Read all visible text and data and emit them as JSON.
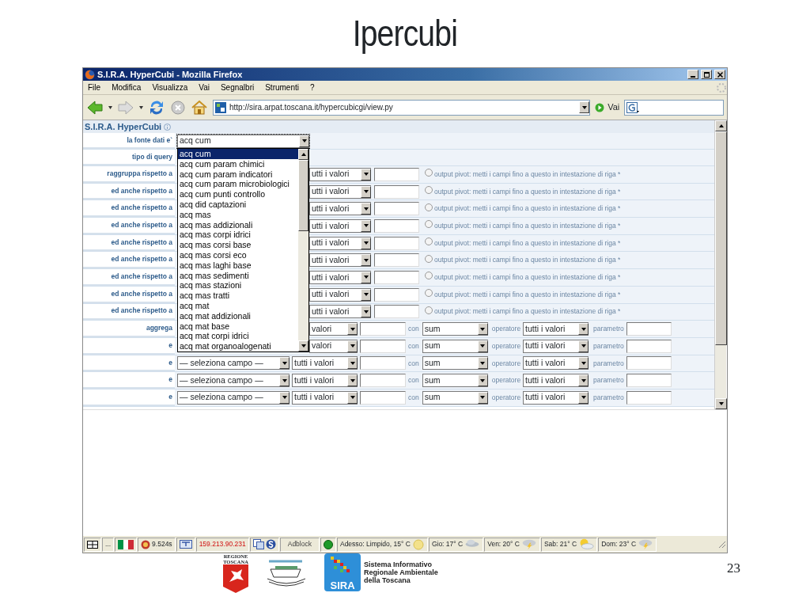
{
  "slide": {
    "title": "Ipercubi",
    "page_number": "23"
  },
  "window": {
    "title": "S.I.R.A. HyperCubi - Mozilla Firefox"
  },
  "menu": [
    "File",
    "Modifica",
    "Visualizza",
    "Vai",
    "Segnalbri",
    "Strumenti",
    "?"
  ],
  "toolbar": {
    "address": "http://sira.arpat.toscana.it/hypercubicgi/view.py",
    "go_label": "Vai"
  },
  "page": {
    "heading": "S.I.R.A. HyperCubi",
    "source": {
      "label": "la fonte dati e`",
      "value": "acq cum",
      "options": [
        {
          "label": "acq cum",
          "selected": true
        },
        {
          "label": "acq cum param chimici",
          "selected": false
        },
        {
          "label": "acq cum param indicatori",
          "selected": false
        },
        {
          "label": "acq cum param microbiologici",
          "selected": false
        },
        {
          "label": "acq cum punti controllo",
          "selected": false
        },
        {
          "label": "acq did captazioni",
          "selected": false
        },
        {
          "label": "acq mas",
          "selected": false
        },
        {
          "label": "acq mas addizionali",
          "selected": false
        },
        {
          "label": "acq mas corpi idrici",
          "selected": false
        },
        {
          "label": "acq mas corsi base",
          "selected": false
        },
        {
          "label": "acq mas corsi eco",
          "selected": false
        },
        {
          "label": "acq mas laghi base",
          "selected": false
        },
        {
          "label": "acq mas sedimenti",
          "selected": false
        },
        {
          "label": "acq mas stazioni",
          "selected": false
        },
        {
          "label": "acq mas tratti",
          "selected": false
        },
        {
          "label": "acq mat",
          "selected": false
        },
        {
          "label": "acq mat addizionali",
          "selected": false
        },
        {
          "label": "acq mat base",
          "selected": false
        },
        {
          "label": "acq mat corpi idrici",
          "selected": false
        },
        {
          "label": "acq mat organoalogenati",
          "selected": false
        }
      ]
    },
    "query_type": {
      "label": "tipo di query"
    },
    "group_rows": [
      {
        "label": "raggruppa rispetto a",
        "values": "utti i valori",
        "pivot_checked": false,
        "pivot_label": "output pivot: metti i campi fino a questo in intestazione di riga *"
      },
      {
        "label": "ed anche rispetto a",
        "values": "utti i valori",
        "pivot_checked": false,
        "pivot_label": "output pivot: metti i campi fino a questo in intestazione di riga *"
      },
      {
        "label": "ed anche rispetto a",
        "values": "utti i valori",
        "pivot_checked": false,
        "pivot_label": "output pivot: metti i campi fino a questo in intestazione di riga *"
      },
      {
        "label": "ed anche rispetto a",
        "values": "utti i valori",
        "pivot_checked": false,
        "pivot_label": "output pivot: metti i campi fino a questo in intestazione di riga *"
      },
      {
        "label": "ed anche rispetto a",
        "values": "utti i valori",
        "pivot_checked": false,
        "pivot_label": "output pivot: metti i campi fino a questo in intestazione di riga *"
      },
      {
        "label": "ed anche rispetto a",
        "values": "utti i valori",
        "pivot_checked": false,
        "pivot_label": "output pivot: metti i campi fino a questo in intestazione di riga *"
      },
      {
        "label": "ed anche rispetto a",
        "values": "utti i valori",
        "pivot_checked": false,
        "pivot_label": "output pivot: metti i campi fino a questo in intestazione di riga *"
      },
      {
        "label": "ed anche rispetto a",
        "values": "utti i valori",
        "pivot_checked": false,
        "pivot_label": "output pivot: metti i campi fino a questo in intestazione di riga *"
      },
      {
        "label": "ed anche rispetto a",
        "values": "utti i valori",
        "pivot_checked": false,
        "pivot_label": "output pivot: metti i campi fino a questo in intestazione di riga *"
      }
    ],
    "aggregate_rows": [
      {
        "label": "aggrega",
        "values": "valori",
        "with_label": "con",
        "function": "sum",
        "operator_label": "operatore",
        "operator": "tutti i valori",
        "parameter_label": "parametro"
      },
      {
        "label": "e",
        "values": "valori",
        "with_label": "con",
        "function": "sum",
        "operator_label": "operatore",
        "operator": "tutti i valori",
        "parameter_label": "parametro"
      },
      {
        "label": "e",
        "field": "— seleziona campo —",
        "values": "tutti i valori",
        "with_label": "con",
        "function": "sum",
        "operator_label": "operatore",
        "operator": "tutti i valori",
        "parameter_label": "parametro"
      },
      {
        "label": "e",
        "field": "— seleziona campo —",
        "values": "tutti i valori",
        "with_label": "con",
        "function": "sum",
        "operator_label": "operatore",
        "operator": "tutti i valori",
        "parameter_label": "parametro"
      },
      {
        "label": "e",
        "field": "— seleziona campo —",
        "values": "tutti i valori",
        "with_label": "con",
        "function": "sum",
        "operator_label": "operatore",
        "operator": "tutti i valori",
        "parameter_label": "parametro"
      }
    ]
  },
  "status_bar": {
    "more": "...",
    "load_time": "9.524s",
    "ip": "159.213.90.231",
    "adblock": "Adblock",
    "weather_now": "Adesso: Limpido, 15° C",
    "forecast": [
      {
        "text": "Gio: 17° C",
        "kind": "cloud"
      },
      {
        "text": "Ven: 20° C",
        "kind": "storm"
      },
      {
        "text": "Sab: 21° C",
        "kind": "suncloud"
      },
      {
        "text": "Dom: 23° C",
        "kind": "storm"
      }
    ]
  },
  "footer": {
    "region_name": "REGIONE TOSCANA",
    "sira_logo_text": "SIRA",
    "sira_name": [
      "Sistema Informativo",
      "Regionale Ambientale",
      "della Toscana"
    ]
  }
}
